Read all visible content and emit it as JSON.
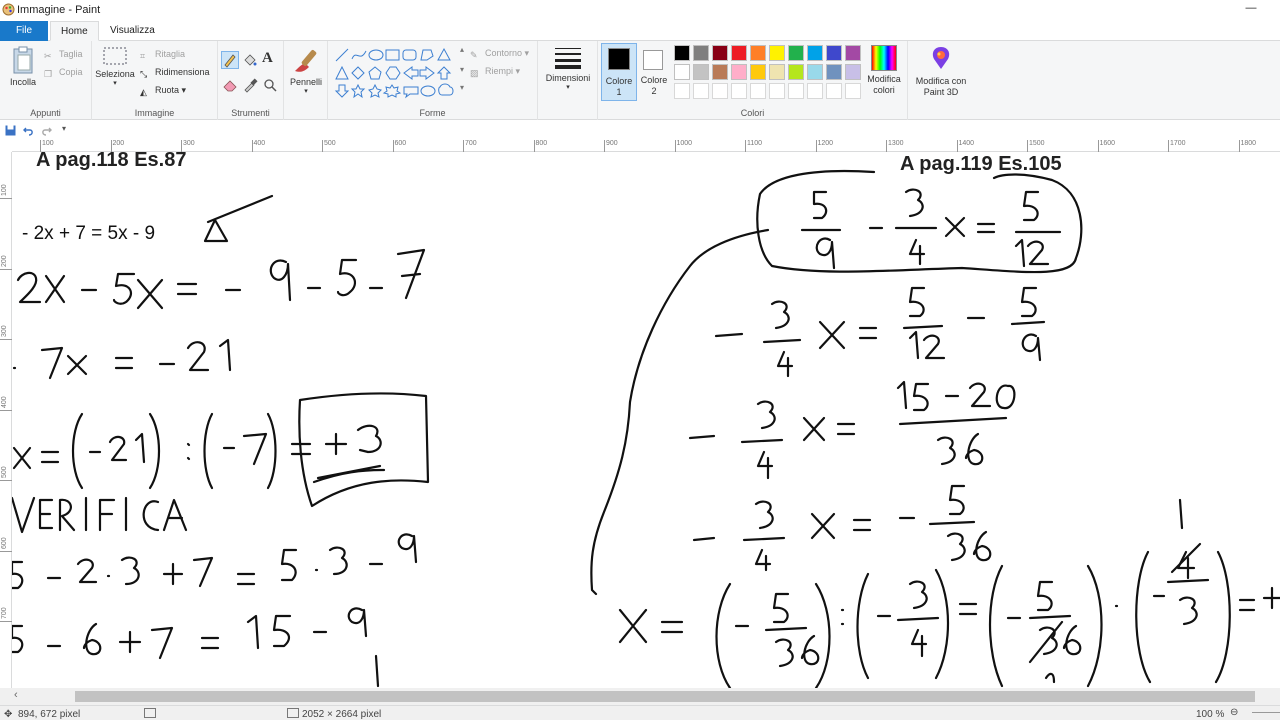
{
  "window": {
    "title": "Immagine - Paint",
    "minimize_label": "—"
  },
  "tabs": [
    {
      "label": "File"
    },
    {
      "label": "Home"
    },
    {
      "label": "Visualizza"
    }
  ],
  "ribbon": {
    "clipboard": {
      "paste_label": "Incolla",
      "cut_label": "Taglia",
      "copy_label": "Copia",
      "group_label": "Appunti"
    },
    "image": {
      "select_label": "Seleziona",
      "crop_label": "Ritaglia",
      "resize_label": "Ridimensiona",
      "rotate_label": "Ruota",
      "group_label": "Immagine"
    },
    "tools": {
      "group_label": "Strumenti",
      "text_glyph": "A"
    },
    "brushes": {
      "label": "Pennelli"
    },
    "shapes": {
      "outline_label": "Contorno",
      "fill_label": "Riempi",
      "group_label": "Forme"
    },
    "size": {
      "label": "Dimensioni"
    },
    "colors": {
      "color1_label": "Colore 1",
      "color2_label": "Colore 2",
      "group_label": "Colori",
      "edit_label": "Modifica colori",
      "paint3d_label": "Modifica con Paint 3D",
      "color1": "#000000",
      "color2": "#ffffff",
      "palette_row1": [
        "#000000",
        "#7f7f7f",
        "#880015",
        "#ed1c24",
        "#ff7f27",
        "#fff200",
        "#22b14c",
        "#00a2e8",
        "#3f48cc",
        "#a349a4"
      ],
      "palette_row2": [
        "#ffffff",
        "#c3c3c3",
        "#b97a57",
        "#ffaec9",
        "#ffc90e",
        "#efe4b0",
        "#b5e61d",
        "#99d9ea",
        "#7092be",
        "#c8bfe7"
      ]
    }
  },
  "ruler": {
    "horizontal_ticks": [
      "100",
      "200",
      "300",
      "400",
      "500",
      "600",
      "700",
      "800",
      "900",
      "1000",
      "1100",
      "1200",
      "1300",
      "1400",
      "1500",
      "1600",
      "1700",
      "1800"
    ],
    "vertical_ticks": [
      "100",
      "200",
      "300",
      "400",
      "500",
      "600",
      "700",
      "800"
    ]
  },
  "canvas": {
    "left_heading": "A pag.118 Es.87",
    "right_heading": "A pag.119 Es.105",
    "left_equation": "- 2x + 7 = 5x - 9"
  },
  "status": {
    "cursor_position": "894, 672 pixel",
    "image_size": "2052 × 2664 pixel",
    "zoom": "100 %"
  }
}
